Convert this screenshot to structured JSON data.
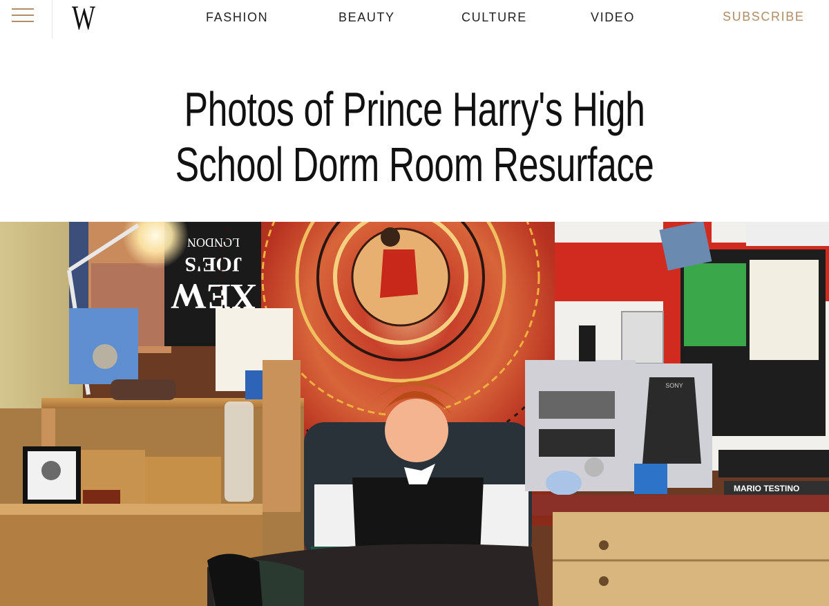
{
  "header": {
    "menu_icon": "hamburger-menu-icon",
    "logo": "W",
    "nav": [
      "FASHION",
      "BEAUTY",
      "CULTURE",
      "VIDEO"
    ],
    "subscribe": "SUBSCRIBE",
    "accent_color": "#b08d62"
  },
  "article": {
    "headline": "Photos of Prince Harry's High School Dorm Room Resurface"
  },
  "hero_image": {
    "poster_text_1": "LONDON",
    "poster_text_2": "JOE'S",
    "poster_text_3": "XEW",
    "magazine_label": "MARIO TESTINO",
    "stereo_brand": "SONY"
  }
}
